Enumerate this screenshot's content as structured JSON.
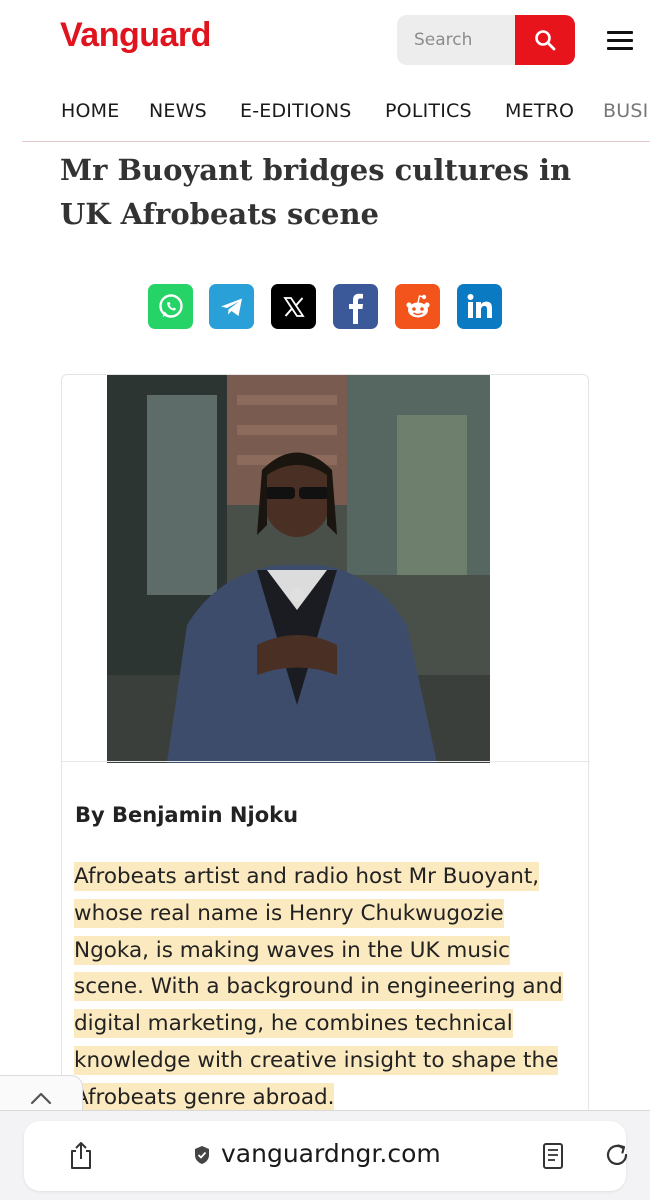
{
  "header": {
    "logo": "Vanguard",
    "brand_color": "#e0141e",
    "search": {
      "placeholder": "Search",
      "icon": "search-icon"
    },
    "menu_icon": "hamburger-menu-icon"
  },
  "nav": {
    "items": [
      "HOME",
      "NEWS",
      "E-EDITIONS",
      "POLITICS",
      "METRO",
      "BUSI"
    ]
  },
  "article": {
    "title": "Mr Buoyant bridges cultures in UK Afrobeats scene",
    "share_buttons": [
      {
        "name": "whatsapp",
        "icon": "whatsapp-icon",
        "color": "#25d366"
      },
      {
        "name": "telegram",
        "icon": "telegram-icon",
        "color": "#2aa0d8"
      },
      {
        "name": "x",
        "icon": "x-icon",
        "color": "#000000"
      },
      {
        "name": "facebook",
        "icon": "facebook-icon",
        "color": "#3b5998"
      },
      {
        "name": "reddit",
        "icon": "reddit-icon",
        "color": "#f2541b"
      },
      {
        "name": "linkedin",
        "icon": "linkedin-icon",
        "color": "#0a7ac2"
      }
    ],
    "image": "photo of Mr Buoyant in a blue suit and sunglasses",
    "byline": "By Benjamin Njoku",
    "body": "Afrobeats artist and radio host Mr Buoyant, whose real name is Henry Chukwugozie Ngoka, is making waves in the UK music scene. With a background in engineering and digital marketing, he combines technical knowledge with creative insight to shape the Afrobeats genre abroad.",
    "highlight_color": "#fbe9c0"
  },
  "browser": {
    "url": "vanguardngr.com",
    "scroll_top_icon": "chevron-up-icon",
    "share_icon": "share-icon",
    "reader_icon": "reader-mode-icon",
    "reload_icon": "reload-icon"
  }
}
